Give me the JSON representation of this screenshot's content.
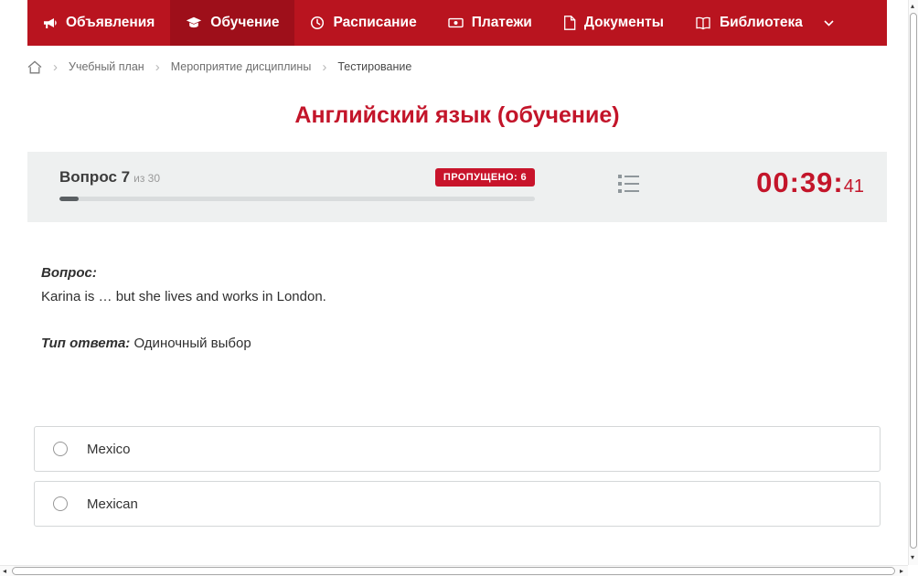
{
  "colors": {
    "nav_background": "#b9141f",
    "nav_active_background": "#9e0f1a",
    "accent_red": "#c3152a",
    "badge_red": "#c8142b",
    "card_background": "#eef0f0"
  },
  "nav": {
    "items": [
      {
        "label": "Объявления",
        "icon": "megaphone-icon",
        "active": false
      },
      {
        "label": "Обучение",
        "icon": "graduation-cap-icon",
        "active": true
      },
      {
        "label": "Расписание",
        "icon": "clock-icon",
        "active": false
      },
      {
        "label": "Платежи",
        "icon": "banknote-icon",
        "active": false
      },
      {
        "label": "Документы",
        "icon": "document-icon",
        "active": false
      },
      {
        "label": "Библиотека",
        "icon": "book-icon",
        "active": false,
        "dropdown": true
      }
    ]
  },
  "breadcrumb": {
    "items": [
      {
        "label": "Учебный план"
      },
      {
        "label": "Мероприятие дисциплины"
      },
      {
        "label": "Тестирование"
      }
    ]
  },
  "page": {
    "title": "Английский язык (обучение)"
  },
  "quiz": {
    "question_label": "Вопрос 7",
    "question_total": "из 30",
    "skipped_badge": "ПРОПУЩЕНО: 6",
    "progress_style": "width:4%",
    "timer_main": "00:39:",
    "timer_seconds": "41"
  },
  "question": {
    "label": "Вопрос:",
    "text": "Karina is … but she lives and works in London.",
    "answer_type_label": "Тип ответа:",
    "answer_type": "Одиночный выбор"
  },
  "answers": [
    {
      "label": "Mexico",
      "selected": false
    },
    {
      "label": "Mexican",
      "selected": false
    }
  ]
}
